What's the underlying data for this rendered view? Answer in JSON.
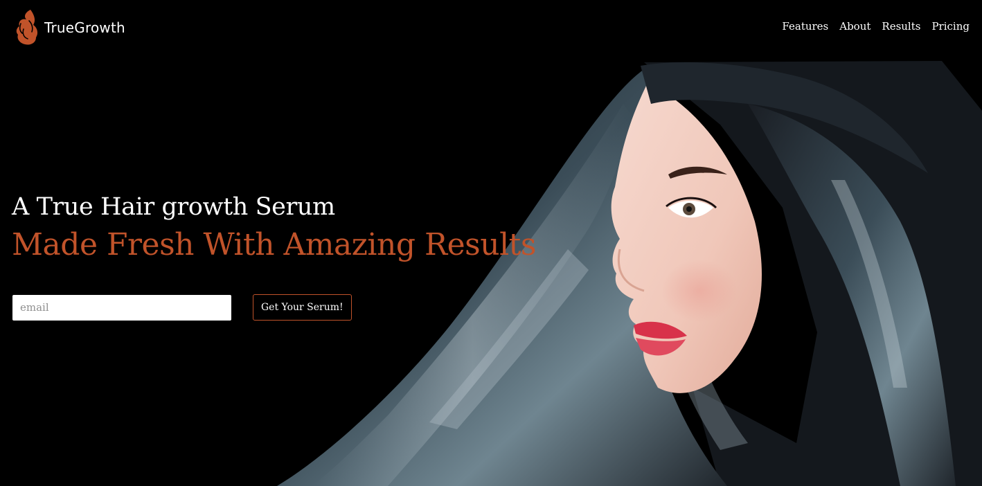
{
  "brand": {
    "name": "TrueGrowth",
    "icon": "flame-hair-icon",
    "accent_color": "#c1532a"
  },
  "nav": {
    "items": [
      {
        "label": "Features"
      },
      {
        "label": "About"
      },
      {
        "label": "Results"
      },
      {
        "label": "Pricing"
      }
    ]
  },
  "hero": {
    "title": "A True Hair growth Serum",
    "subtitle": "Made Fresh With Amazing Results",
    "image": "woman-with-long-dark-hair-profile"
  },
  "signup": {
    "email_placeholder": "email",
    "email_value": "",
    "button_label": "Get Your Serum!"
  }
}
